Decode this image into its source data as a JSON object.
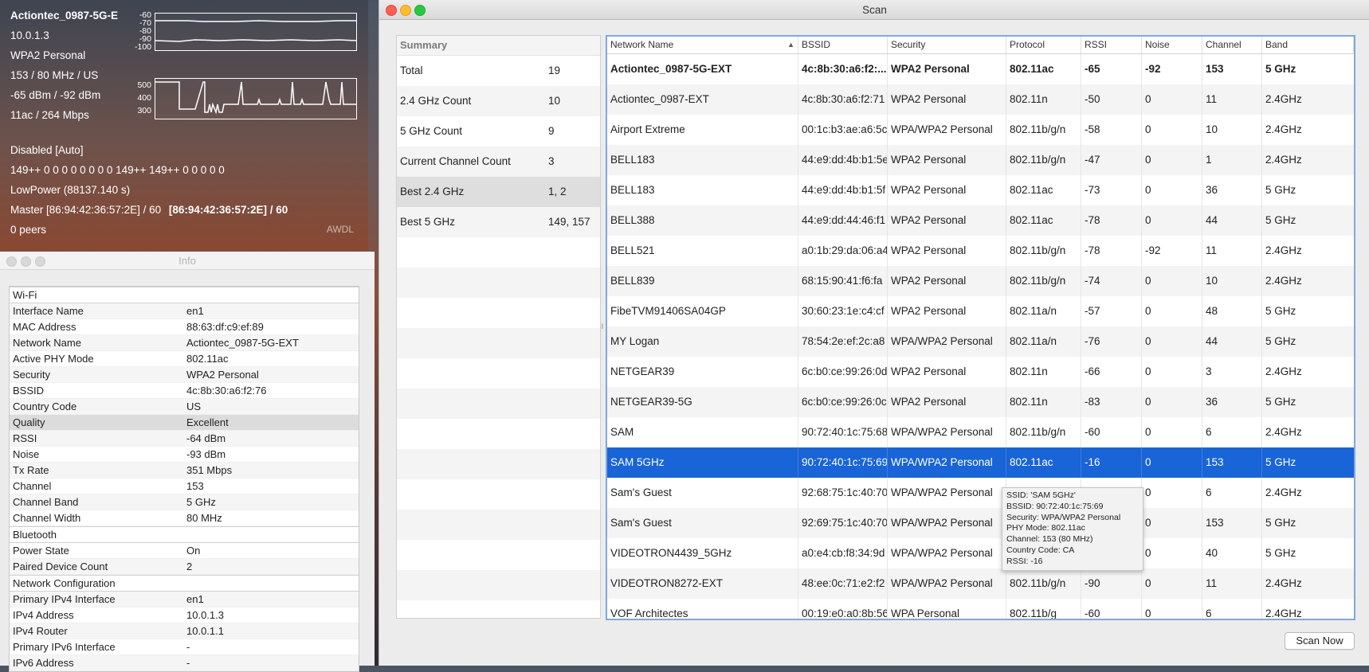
{
  "hud": {
    "lines": [
      "Actiontec_0987-5G-E",
      "10.0.1.3",
      "WPA2 Personal",
      "153 / 80 MHz / US",
      "-65 dBm / -92 dBm",
      "11ac / 264 Mbps",
      "Disabled [Auto]",
      "149++ 0 0 0 0 0 0 0 0 149++ 149++ 0 0 0 0 0",
      "LowPower (88137.140 s)",
      "0 peers"
    ],
    "master_label": "Master [86:94:42:36:57:2E] / 60",
    "master_bold": "[86:94:42:36:57:2E] / 60",
    "awdl": "AWDL",
    "graph1_scale": [
      "-60",
      "-70",
      "-80",
      "-90",
      "-100"
    ],
    "graph2_scale": [
      "500",
      "400",
      "300"
    ]
  },
  "info": {
    "title": "Info",
    "rows": [
      {
        "k": "Wi-Fi",
        "v": "",
        "group": true
      },
      {
        "k": "Interface Name",
        "v": "en1"
      },
      {
        "k": "MAC Address",
        "v": "88:63:df:c9:ef:89"
      },
      {
        "k": "Network Name",
        "v": "Actiontec_0987-5G-EXT"
      },
      {
        "k": "Active PHY Mode",
        "v": "802.11ac"
      },
      {
        "k": "Security",
        "v": "WPA2 Personal"
      },
      {
        "k": "BSSID",
        "v": "4c:8b:30:a6:f2:76"
      },
      {
        "k": "Country Code",
        "v": "US"
      },
      {
        "k": "Quality",
        "v": "Excellent",
        "selected": true
      },
      {
        "k": "RSSI",
        "v": "-64 dBm"
      },
      {
        "k": "Noise",
        "v": "-93 dBm"
      },
      {
        "k": "Tx Rate",
        "v": "351 Mbps"
      },
      {
        "k": "Channel",
        "v": "153"
      },
      {
        "k": "Channel Band",
        "v": "5 GHz"
      },
      {
        "k": "Channel Width",
        "v": "80 MHz"
      },
      {
        "k": "Bluetooth",
        "v": "",
        "group": true
      },
      {
        "k": "Power State",
        "v": "On"
      },
      {
        "k": "Paired Device Count",
        "v": "2"
      },
      {
        "k": "Network Configuration",
        "v": "",
        "group": true
      },
      {
        "k": "Primary IPv4 Interface",
        "v": "en1"
      },
      {
        "k": "IPv4 Address",
        "v": "10.0.1.3"
      },
      {
        "k": "IPv4 Router",
        "v": "10.0.1.1"
      },
      {
        "k": "Primary IPv6 Interface",
        "v": "-"
      },
      {
        "k": "IPv6 Address",
        "v": "-"
      }
    ]
  },
  "scan": {
    "title": "Scan",
    "summary_header": "Summary",
    "summary": [
      {
        "k": "Total",
        "v": "19"
      },
      {
        "k": "2.4 GHz Count",
        "v": "10"
      },
      {
        "k": "5 GHz Count",
        "v": "9"
      },
      {
        "k": "Current Channel Count",
        "v": "3"
      },
      {
        "k": "Best 2.4 GHz",
        "v": "1, 2",
        "selected": true
      },
      {
        "k": "Best 5 GHz",
        "v": "149, 157"
      }
    ],
    "columns": [
      "Network Name",
      "BSSID",
      "Security",
      "Protocol",
      "RSSI",
      "Noise",
      "Channel",
      "Band"
    ],
    "sort_indicator": "▲",
    "rows": [
      [
        "Actiontec_0987-5G-EXT",
        "4c:8b:30:a6:f2:...",
        "WPA2 Personal",
        "802.11ac",
        "-65",
        "-92",
        "153",
        "5 GHz"
      ],
      [
        "Actiontec_0987-EXT",
        "4c:8b:30:a6:f2:71",
        "WPA2 Personal",
        "802.11n",
        "-50",
        "0",
        "11",
        "2.4GHz"
      ],
      [
        "Airport Extreme",
        "00:1c:b3:ae:a6:5c",
        "WPA/WPA2 Personal",
        "802.11b/g/n",
        "-58",
        "0",
        "10",
        "2.4GHz"
      ],
      [
        "BELL183",
        "44:e9:dd:4b:b1:5e",
        "WPA2 Personal",
        "802.11b/g/n",
        "-47",
        "0",
        "1",
        "2.4GHz"
      ],
      [
        "BELL183",
        "44:e9:dd:4b:b1:5f",
        "WPA2 Personal",
        "802.11ac",
        "-73",
        "0",
        "36",
        "5 GHz"
      ],
      [
        "BELL388",
        "44:e9:dd:44:46:f1",
        "WPA2 Personal",
        "802.11ac",
        "-78",
        "0",
        "44",
        "5 GHz"
      ],
      [
        "BELL521",
        "a0:1b:29:da:06:a4",
        "WPA2 Personal",
        "802.11b/g/n",
        "-78",
        "-92",
        "11",
        "2.4GHz"
      ],
      [
        "BELL839",
        "68:15:90:41:f6:fa",
        "WPA2 Personal",
        "802.11b/g/n",
        "-74",
        "0",
        "10",
        "2.4GHz"
      ],
      [
        "FibeTVM91406SA04GP",
        "30:60:23:1e:c4:cf",
        "WPA2 Personal",
        "802.11a/n",
        "-57",
        "0",
        "48",
        "5 GHz"
      ],
      [
        "MY Logan",
        "78:54:2e:ef:2c:a8",
        "WPA/WPA2 Personal",
        "802.11a/n",
        "-76",
        "0",
        "44",
        "5 GHz"
      ],
      [
        "NETGEAR39",
        "6c:b0:ce:99:26:0d",
        "WPA2 Personal",
        "802.11n",
        "-66",
        "0",
        "3",
        "2.4GHz"
      ],
      [
        "NETGEAR39-5G",
        "6c:b0:ce:99:26:0c",
        "WPA2 Personal",
        "802.11n",
        "-83",
        "0",
        "36",
        "5 GHz"
      ],
      [
        "SAM",
        "90:72:40:1c:75:68",
        "WPA/WPA2 Personal",
        "802.11b/g/n",
        "-60",
        "0",
        "6",
        "2.4GHz"
      ],
      [
        "SAM 5GHz",
        "90:72:40:1c:75:69",
        "WPA/WPA2 Personal",
        "802.11ac",
        "-16",
        "0",
        "153",
        "5 GHz"
      ],
      [
        "Sam's Guest",
        "92:68:75:1c:40:70",
        "WPA/WPA2 Personal",
        "802.11b/g/n",
        "-11",
        "0",
        "6",
        "2.4GHz"
      ],
      [
        "Sam's Guest",
        "92:69:75:1c:40:70",
        "WPA/WPA2 Personal",
        "802.11ac",
        "-16",
        "0",
        "153",
        "5 GHz"
      ],
      [
        "VIDEOTRON4439_5GHz",
        "a0:e4:cb:f8:34:9d",
        "WPA/WPA2 Personal",
        "802.11ac",
        "-83",
        "0",
        "40",
        "5 GHz"
      ],
      [
        "VIDEOTRON8272-EXT",
        "48:ee:0c:71:e2:f2",
        "WPA/WPA2 Personal",
        "802.11b/g/n",
        "-90",
        "0",
        "11",
        "2.4GHz"
      ],
      [
        "VOF Architectes",
        "00:19:e0:a0:8b:56",
        "WPA Personal",
        "802.11b/g",
        "-60",
        "0",
        "6",
        "2.4GHz"
      ]
    ],
    "current_row_index": 0,
    "selected_row_index": 13,
    "tooltip": [
      "SSID: 'SAM 5GHz'",
      "BSSID: 90:72:40:1c:75:69",
      "Security: WPA/WPA2 Personal",
      "PHY Mode: 802.11ac",
      "Channel: 153 (80 MHz)",
      "Country Code: CA",
      "RSSI: -16"
    ],
    "scan_button": "Scan Now"
  }
}
